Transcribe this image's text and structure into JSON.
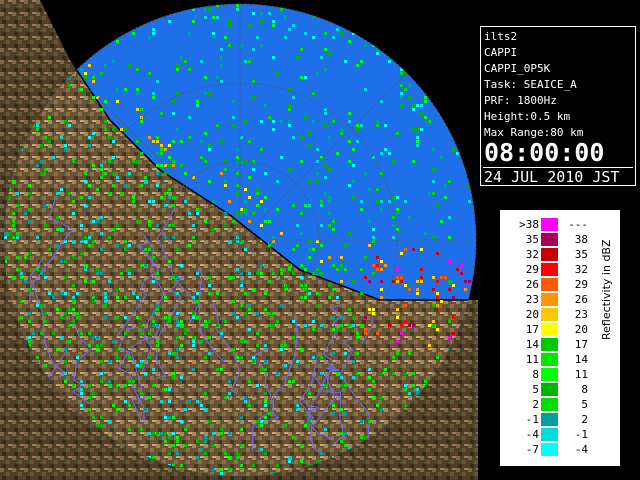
{
  "radar": {
    "station": "ilts2",
    "product": "CAPPI",
    "product_name": "CAPPI_0P5K",
    "task": "Task: SEAICE_A",
    "prf": "PRF: 1800Hz",
    "height": "Height:0.5 km",
    "max_range": "Max Range:80 km",
    "time": "08:00:00",
    "date": "24 JUL 2010 JST"
  },
  "legend": {
    "unit": "Reflectivity in dBZ",
    "rows": [
      {
        "lo": ">38",
        "hi": "---",
        "color": "#ff00ff"
      },
      {
        "lo": "35",
        "hi": "38",
        "color": "#a8005a"
      },
      {
        "lo": "32",
        "hi": "35",
        "color": "#c80000"
      },
      {
        "lo": "29",
        "hi": "32",
        "color": "#ff0000"
      },
      {
        "lo": "26",
        "hi": "29",
        "color": "#ff5a00"
      },
      {
        "lo": "23",
        "hi": "26",
        "color": "#ff9600"
      },
      {
        "lo": "20",
        "hi": "23",
        "color": "#ffc800"
      },
      {
        "lo": "17",
        "hi": "20",
        "color": "#ffff00"
      },
      {
        "lo": "14",
        "hi": "17",
        "color": "#00c800"
      },
      {
        "lo": "11",
        "hi": "14",
        "color": "#00e600"
      },
      {
        "lo": "8",
        "hi": "11",
        "color": "#00ff00"
      },
      {
        "lo": "5",
        "hi": "8",
        "color": "#00b400"
      },
      {
        "lo": "2",
        "hi": "5",
        "color": "#00dc00"
      },
      {
        "lo": "-1",
        "hi": "2",
        "color": "#00a0a0"
      },
      {
        "lo": "-4",
        "hi": "-1",
        "color": "#00dcdc"
      },
      {
        "lo": "-7",
        "hi": "-4",
        "color": "#00ffff"
      }
    ]
  },
  "colors": {
    "sea": "#1f6fe8",
    "land_dark": "#5a4228",
    "land_light": "#a08258",
    "rivers": "#6a6aff",
    "coast": "#000000"
  }
}
